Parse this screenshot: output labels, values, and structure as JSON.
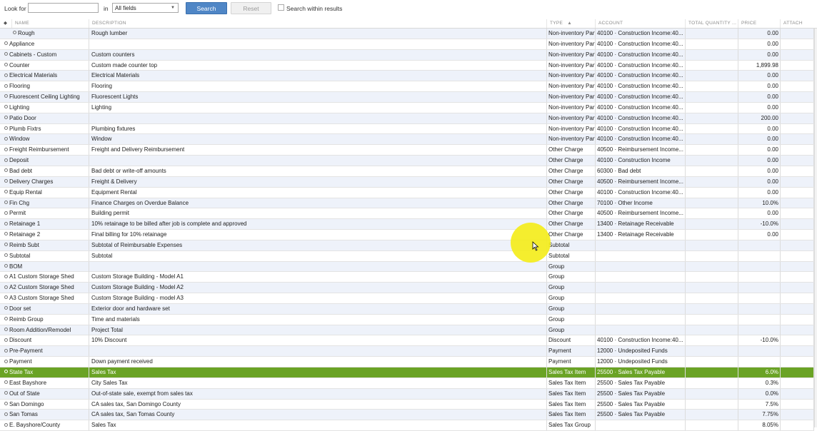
{
  "search": {
    "look_for_label": "Look for",
    "look_for_value": "",
    "in_label": "in",
    "field_value": "All fields",
    "search_label": "Search",
    "reset_label": "Reset",
    "within_label": "Search within results"
  },
  "columns": {
    "sort": "◆",
    "name": "NAME",
    "description": "DESCRIPTION",
    "type": "TYPE",
    "type_sort": "▲",
    "account": "ACCOUNT",
    "total_quantity": "TOTAL QUANTITY ...",
    "price": "PRICE",
    "attach": "ATTACH"
  },
  "rows": [
    {
      "name": "Rough",
      "desc": "Rough lumber",
      "type": "Non-inventory Part",
      "account": "40100 · Construction Income:40...",
      "price": "0.00"
    },
    {
      "name": "Appliance",
      "desc": "",
      "type": "Non-inventory Part",
      "account": "40100 · Construction Income:40...",
      "price": "0.00"
    },
    {
      "name": "Cabinets - Custom",
      "desc": "Custom counters",
      "type": "Non-inventory Part",
      "account": "40100 · Construction Income:40...",
      "price": "0.00"
    },
    {
      "name": "Counter",
      "desc": "Custom made counter top",
      "type": "Non-inventory Part",
      "account": "40100 · Construction Income:40...",
      "price": "1,899.98"
    },
    {
      "name": "Electrical Materials",
      "desc": "Electrical Materials",
      "type": "Non-inventory Part",
      "account": "40100 · Construction Income:40...",
      "price": "0.00"
    },
    {
      "name": "Flooring",
      "desc": "Flooring",
      "type": "Non-inventory Part",
      "account": "40100 · Construction Income:40...",
      "price": "0.00"
    },
    {
      "name": "Fluorescent Ceiling Lighting",
      "desc": "Fluorescent Lights",
      "type": "Non-inventory Part",
      "account": "40100 · Construction Income:40...",
      "price": "0.00"
    },
    {
      "name": "Lighting",
      "desc": "Lighting",
      "type": "Non-inventory Part",
      "account": "40100 · Construction Income:40...",
      "price": "0.00"
    },
    {
      "name": "Patio Door",
      "desc": "",
      "type": "Non-inventory Part",
      "account": "40100 · Construction Income:40...",
      "price": "200.00"
    },
    {
      "name": "Plumb Fixtrs",
      "desc": "Plumbing fixtures",
      "type": "Non-inventory Part",
      "account": "40100 · Construction Income:40...",
      "price": "0.00"
    },
    {
      "name": "Window",
      "desc": "Window",
      "type": "Non-inventory Part",
      "account": "40100 · Construction Income:40...",
      "price": "0.00"
    },
    {
      "name": "Freight Reimbursement",
      "desc": "Freight and Delivery Reimbursement",
      "type": "Other Charge",
      "account": "40500 · Reimbursement Income...",
      "price": "0.00"
    },
    {
      "name": "Deposit",
      "desc": "",
      "type": "Other Charge",
      "account": "40100 · Construction Income",
      "price": "0.00"
    },
    {
      "name": "Bad debt",
      "desc": "Bad debt or write-off amounts",
      "type": "Other Charge",
      "account": "60300 · Bad debt",
      "price": "0.00"
    },
    {
      "name": "Delivery Charges",
      "desc": "Freight & Delivery",
      "type": "Other Charge",
      "account": "40500 · Reimbursement Income...",
      "price": "0.00"
    },
    {
      "name": "Equip Rental",
      "desc": "Equipment Rental",
      "type": "Other Charge",
      "account": "40100 · Construction Income:40...",
      "price": "0.00"
    },
    {
      "name": "Fin Chg",
      "desc": "Finance Charges on Overdue Balance",
      "type": "Other Charge",
      "account": "70100 · Other Income",
      "price": "10.0%"
    },
    {
      "name": "Permit",
      "desc": "Building permit",
      "type": "Other Charge",
      "account": "40500 · Reimbursement Income...",
      "price": "0.00"
    },
    {
      "name": "Retainage 1",
      "desc": "10% retainage to be billed after job is complete and approved",
      "type": "Other Charge",
      "account": "13400 · Retainage Receivable",
      "price": "-10.0%"
    },
    {
      "name": "Retainage 2",
      "desc": "Final billing for 10% retainage",
      "type": "Other Charge",
      "account": "13400 · Retainage Receivable",
      "price": "0.00"
    },
    {
      "name": "Reimb Subt",
      "desc": "Subtotal of Reimbursable Expenses",
      "type": "Subtotal",
      "account": "",
      "price": ""
    },
    {
      "name": "Subtotal",
      "desc": "Subtotal",
      "type": "Subtotal",
      "account": "",
      "price": ""
    },
    {
      "name": "BOM",
      "desc": "",
      "type": "Group",
      "account": "",
      "price": ""
    },
    {
      "name": "A1 Custom Storage Shed",
      "desc": "Custom Storage Building - Model A1",
      "type": "Group",
      "account": "",
      "price": ""
    },
    {
      "name": "A2 Custom Storage Shed",
      "desc": "Custom Storage Building - Model A2",
      "type": "Group",
      "account": "",
      "price": ""
    },
    {
      "name": "A3 Custom Storage Shed",
      "desc": "Custom Storage Building - model A3",
      "type": "Group",
      "account": "",
      "price": ""
    },
    {
      "name": "Door set",
      "desc": "Exterior door and hardware set",
      "type": "Group",
      "account": "",
      "price": ""
    },
    {
      "name": "Reimb Group",
      "desc": "Time and materials",
      "type": "Group",
      "account": "",
      "price": ""
    },
    {
      "name": "Room Addition/Remodel",
      "desc": "Project Total",
      "type": "Group",
      "account": "",
      "price": ""
    },
    {
      "name": "Discount",
      "desc": "10% Discount",
      "type": "Discount",
      "account": "40100 · Construction Income:40...",
      "price": "-10.0%"
    },
    {
      "name": "Pre-Payment",
      "desc": "",
      "type": "Payment",
      "account": "12000 · Undeposited Funds",
      "price": ""
    },
    {
      "name": "Payment",
      "desc": "Down payment received",
      "type": "Payment",
      "account": "12000 · Undeposited Funds",
      "price": ""
    },
    {
      "name": "State Tax",
      "desc": "Sales Tax",
      "type": "Sales Tax Item",
      "account": "25500 · Sales Tax Payable",
      "price": "6.0%"
    },
    {
      "name": "East Bayshore",
      "desc": "City Sales Tax",
      "type": "Sales Tax Item",
      "account": "25500 · Sales Tax Payable",
      "price": "0.3%"
    },
    {
      "name": "Out of State",
      "desc": "Out-of-state sale, exempt from sales tax",
      "type": "Sales Tax Item",
      "account": "25500 · Sales Tax Payable",
      "price": "0.0%"
    },
    {
      "name": "San Domingo",
      "desc": "CA sales tax, San Domingo County",
      "type": "Sales Tax Item",
      "account": "25500 · Sales Tax Payable",
      "price": "7.5%"
    },
    {
      "name": "San Tomas",
      "desc": "CA sales tax, San Tomas County",
      "type": "Sales Tax Item",
      "account": "25500 · Sales Tax Payable",
      "price": "7.75%"
    },
    {
      "name": "E. Bayshore/County",
      "desc": "Sales Tax",
      "type": "Sales Tax Group",
      "account": "",
      "price": "8.05%"
    }
  ],
  "selected_name": "State Tax"
}
